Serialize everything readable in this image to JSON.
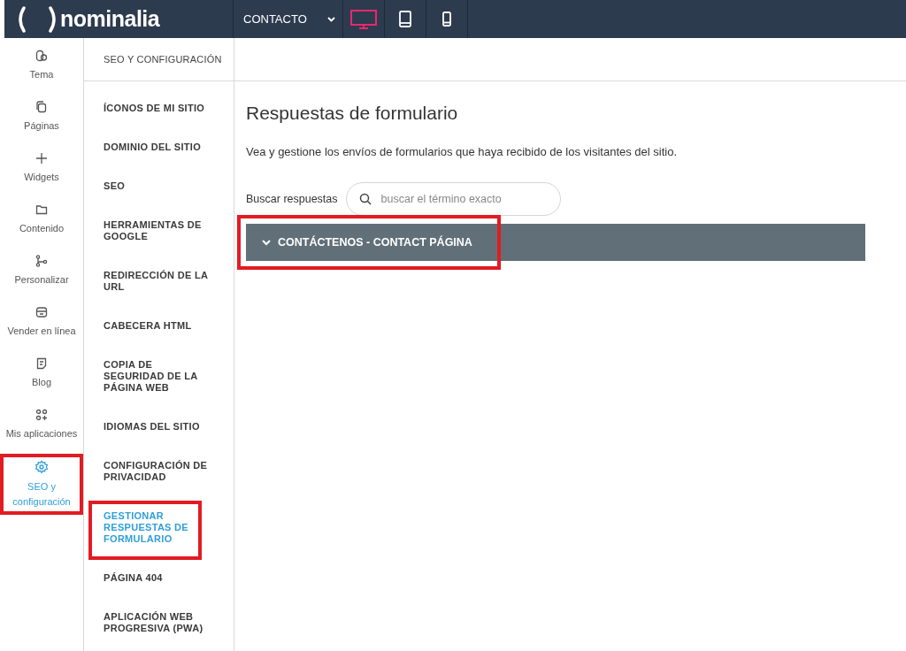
{
  "topbar": {
    "logo": "nominalia",
    "page_select": {
      "value": "CONTACTO"
    },
    "devices": [
      {
        "kind": "desktop",
        "selected": true
      },
      {
        "kind": "tablet",
        "selected": false
      },
      {
        "kind": "phone",
        "selected": false
      }
    ]
  },
  "rail": [
    {
      "kind": "theme",
      "label": "Tema",
      "selected": false,
      "highlighted": false
    },
    {
      "kind": "pages",
      "label": "Páginas",
      "selected": false,
      "highlighted": false
    },
    {
      "kind": "widgets",
      "label": "Widgets",
      "selected": false,
      "highlighted": false
    },
    {
      "kind": "content",
      "label": "Contenido",
      "selected": false,
      "highlighted": false
    },
    {
      "kind": "personalize",
      "label": "Personalizar",
      "selected": false,
      "highlighted": false
    },
    {
      "kind": "store",
      "label": "Vender en línea",
      "selected": false,
      "highlighted": false
    },
    {
      "kind": "blog",
      "label": "Blog",
      "selected": false,
      "highlighted": false
    },
    {
      "kind": "apps",
      "label": "Mis aplicaciones",
      "selected": false,
      "highlighted": false
    },
    {
      "kind": "settings",
      "label": "SEO y configuración",
      "selected": true,
      "highlighted": true
    }
  ],
  "settings_panel": {
    "title": "SEO Y CONFIGURACIÓN",
    "items": [
      {
        "label": "ÍCONOS DE MI SITIO",
        "selected": false,
        "highlighted": false
      },
      {
        "label": "DOMINIO DEL SITIO",
        "selected": false,
        "highlighted": false
      },
      {
        "label": "SEO",
        "selected": false,
        "highlighted": false
      },
      {
        "label": "HERRAMIENTAS DE GOOGLE",
        "selected": false,
        "highlighted": false
      },
      {
        "label": "REDIRECCIÓN DE LA URL",
        "selected": false,
        "highlighted": false
      },
      {
        "label": "CABECERA HTML",
        "selected": false,
        "highlighted": false
      },
      {
        "label": "COPIA DE SEGURIDAD DE LA PÁGINA WEB",
        "selected": false,
        "highlighted": false
      },
      {
        "label": "IDIOMAS DEL SITIO",
        "selected": false,
        "highlighted": false
      },
      {
        "label": "CONFIGURACIÓN DE PRIVACIDAD",
        "selected": false,
        "highlighted": false
      },
      {
        "label": "GESTIONAR RESPUESTAS DE FORMULARIO",
        "selected": true,
        "highlighted": true
      },
      {
        "label": "PÁGINA 404",
        "selected": false,
        "highlighted": false
      },
      {
        "label": "APLICACIÓN WEB PROGRESIVA (PWA)",
        "selected": false,
        "highlighted": false
      }
    ]
  },
  "main": {
    "title": "Respuestas de formulario",
    "description": "Vea y gestione los envíos de formularios que haya recibido de los visitantes del sitio.",
    "search": {
      "label": "Buscar respuestas",
      "placeholder": "buscar el término exacto"
    },
    "forms": [
      {
        "title": "CONTÁCTENOS - CONTACT PÁGINA",
        "expanded": false,
        "highlighted": true
      }
    ]
  }
}
